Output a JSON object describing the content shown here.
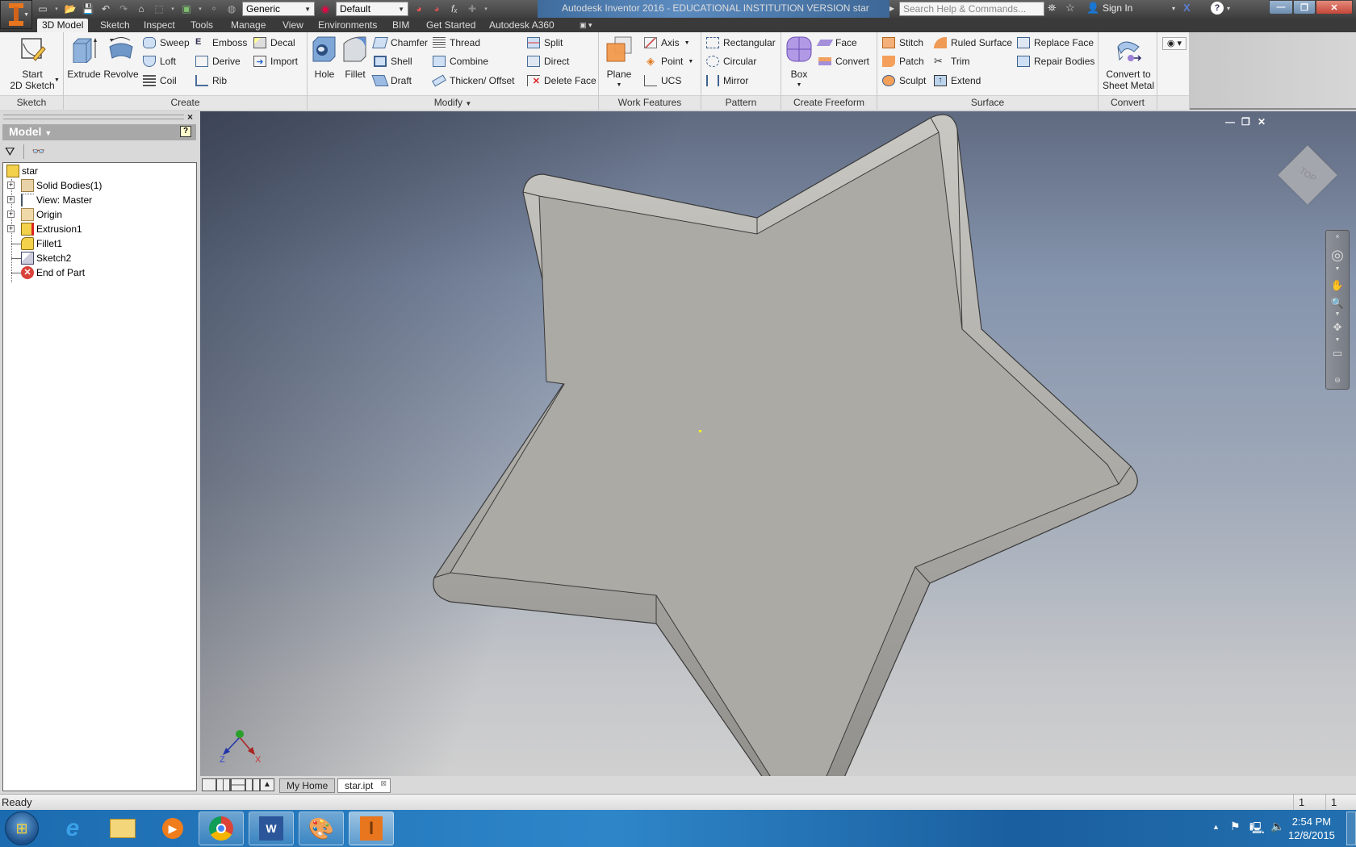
{
  "app": {
    "title": "Autodesk Inventor 2016 - EDUCATIONAL INSTITUTION VERSION    star",
    "search_placeholder": "Search Help & Commands...",
    "sign_in": "Sign In",
    "material_select": "Generic",
    "appearance_select": "Default"
  },
  "ribbon_tabs": [
    "3D Model",
    "Sketch",
    "Inspect",
    "Tools",
    "Manage",
    "View",
    "Environments",
    "BIM",
    "Get Started",
    "Autodesk A360"
  ],
  "active_tab": "3D Model",
  "panels": {
    "sketch": {
      "label": "Sketch",
      "start_line1": "Start",
      "start_line2": "2D Sketch"
    },
    "create": {
      "label": "Create",
      "extrude": "Extrude",
      "revolve": "Revolve",
      "sweep": "Sweep",
      "loft": "Loft",
      "coil": "Coil",
      "emboss": "Emboss",
      "derive": "Derive",
      "rib": "Rib",
      "decal": "Decal",
      "import": "Import"
    },
    "modify": {
      "label": "Modify",
      "hole": "Hole",
      "fillet": "Fillet",
      "chamfer": "Chamfer",
      "shell": "Shell",
      "draft": "Draft",
      "thread": "Thread",
      "combine": "Combine",
      "thicken": "Thicken/ Offset",
      "split": "Split",
      "direct": "Direct",
      "delete_face": "Delete Face"
    },
    "work_features": {
      "label": "Work Features",
      "plane": "Plane",
      "axis": "Axis",
      "point": "Point",
      "ucs": "UCS"
    },
    "pattern": {
      "label": "Pattern",
      "rectangular": "Rectangular",
      "circular": "Circular",
      "mirror": "Mirror"
    },
    "create_freeform": {
      "label": "Create Freeform",
      "box": "Box",
      "face": "Face",
      "convert": "Convert"
    },
    "surface": {
      "label": "Surface",
      "stitch": "Stitch",
      "patch": "Patch",
      "sculpt": "Sculpt",
      "ruled_surface": "Ruled Surface",
      "trim": "Trim",
      "extend": "Extend",
      "replace_face": "Replace Face",
      "repair_bodies": "Repair Bodies"
    },
    "convert": {
      "label": "Convert",
      "line1": "Convert to",
      "line2": "Sheet Metal"
    }
  },
  "browser": {
    "header": "Model",
    "tree": [
      {
        "label": "star",
        "icon": "part-icon",
        "expandable": false
      },
      {
        "label": "Solid Bodies(1)",
        "icon": "solid-bodies-icon",
        "expandable": true
      },
      {
        "label": "View: Master",
        "icon": "view-rep-icon",
        "expandable": true
      },
      {
        "label": "Origin",
        "icon": "folder-icon",
        "expandable": true
      },
      {
        "label": "Extrusion1",
        "icon": "extrusion-icon",
        "expandable": true
      },
      {
        "label": "Fillet1",
        "icon": "fillet-icon",
        "expandable": false
      },
      {
        "label": "Sketch2",
        "icon": "sketch-icon",
        "expandable": false
      },
      {
        "label": "End of Part",
        "icon": "end-of-part-icon",
        "expandable": false
      }
    ]
  },
  "viewport": {
    "viewcube_face": "TOP",
    "triad": {
      "x": "X",
      "z": "Z"
    }
  },
  "doc_tabs": [
    "My Home",
    "star.ipt"
  ],
  "active_doc": "star.ipt",
  "status": {
    "text": "Ready",
    "count1": "1",
    "count2": "1"
  },
  "taskbar": {
    "apps": [
      "Windows Start",
      "Internet Explorer",
      "File Explorer",
      "Windows Media Player",
      "Google Chrome",
      "Microsoft Word",
      "Paint",
      "Autodesk Inventor"
    ],
    "time": "2:54 PM",
    "date": "12/8/2015"
  },
  "colors": {
    "accent_orange": "#e8761f",
    "part_gray": "#abaaa5",
    "viewport_top": "#5f6a80",
    "viewport_bottom": "#d0d0d0"
  }
}
